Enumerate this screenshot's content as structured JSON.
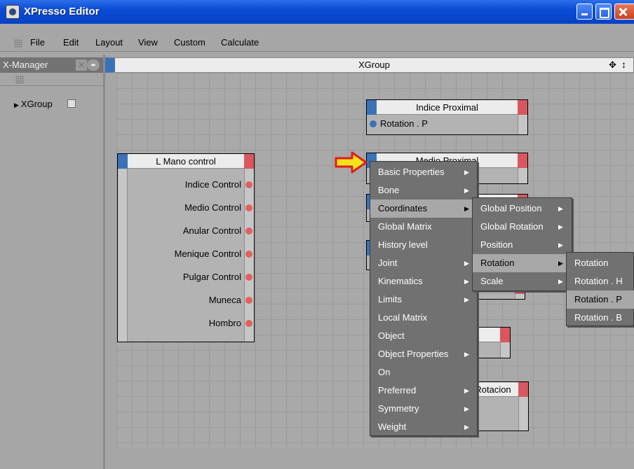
{
  "window": {
    "title": "XPresso Editor"
  },
  "menubar": [
    "File",
    "Edit",
    "Layout",
    "View",
    "Custom",
    "Calculate"
  ],
  "xmanager": {
    "title": "X-Manager",
    "tree_item": "XGroup"
  },
  "xgroup": {
    "title": "XGroup"
  },
  "nodes": {
    "indice_proximal": {
      "title": "Indice Proximal",
      "port": "Rotation . P"
    },
    "medio_proximal": {
      "title": "Medio Proximal"
    },
    "l_mano_control": {
      "title": "L Mano control",
      "ports": [
        "Indice Control",
        "Medio Control",
        "Anular Control",
        "Menique Control",
        "Pulgar Control",
        "Muneca",
        "Hombro"
      ]
    },
    "rotacion": {
      "title": "Rotacion"
    }
  },
  "context_menu": {
    "items": [
      {
        "label": "Basic Properties",
        "submenu": true
      },
      {
        "label": "Bone",
        "submenu": true
      },
      {
        "label": "Coordinates",
        "submenu": true
      },
      {
        "label": "Global Matrix",
        "submenu": false
      },
      {
        "label": "History level",
        "submenu": false
      },
      {
        "label": "Joint",
        "submenu": true
      },
      {
        "label": "Kinematics",
        "submenu": true
      },
      {
        "label": "Limits",
        "submenu": true
      },
      {
        "label": "Local Matrix",
        "submenu": false
      },
      {
        "label": "Object",
        "submenu": false
      },
      {
        "label": "Object Properties",
        "submenu": true
      },
      {
        "label": "On",
        "submenu": false
      },
      {
        "label": "Preferred",
        "submenu": true
      },
      {
        "label": "Symmetry",
        "submenu": true
      },
      {
        "label": "Weight",
        "submenu": true
      }
    ],
    "highlighted": "Coordinates"
  },
  "coordinates_menu": {
    "items": [
      {
        "label": "Global Position",
        "submenu": true
      },
      {
        "label": "Global Rotation",
        "submenu": true
      },
      {
        "label": "Position",
        "submenu": true
      },
      {
        "label": "Rotation",
        "submenu": true
      },
      {
        "label": "Scale",
        "submenu": true
      }
    ],
    "highlighted": "Rotation"
  },
  "rotation_menu": {
    "items": [
      {
        "label": "Rotation"
      },
      {
        "label": "Rotation . H"
      },
      {
        "label": "Rotation . P"
      },
      {
        "label": "Rotation . B"
      }
    ],
    "highlighted": "Rotation . P"
  },
  "colors": {
    "accent_blue": "#3a72b7",
    "port_red": "#e0615e",
    "menu_bg": "#717171",
    "arrow_yellow": "#f5e21a",
    "arrow_red": "#e01b1b"
  }
}
